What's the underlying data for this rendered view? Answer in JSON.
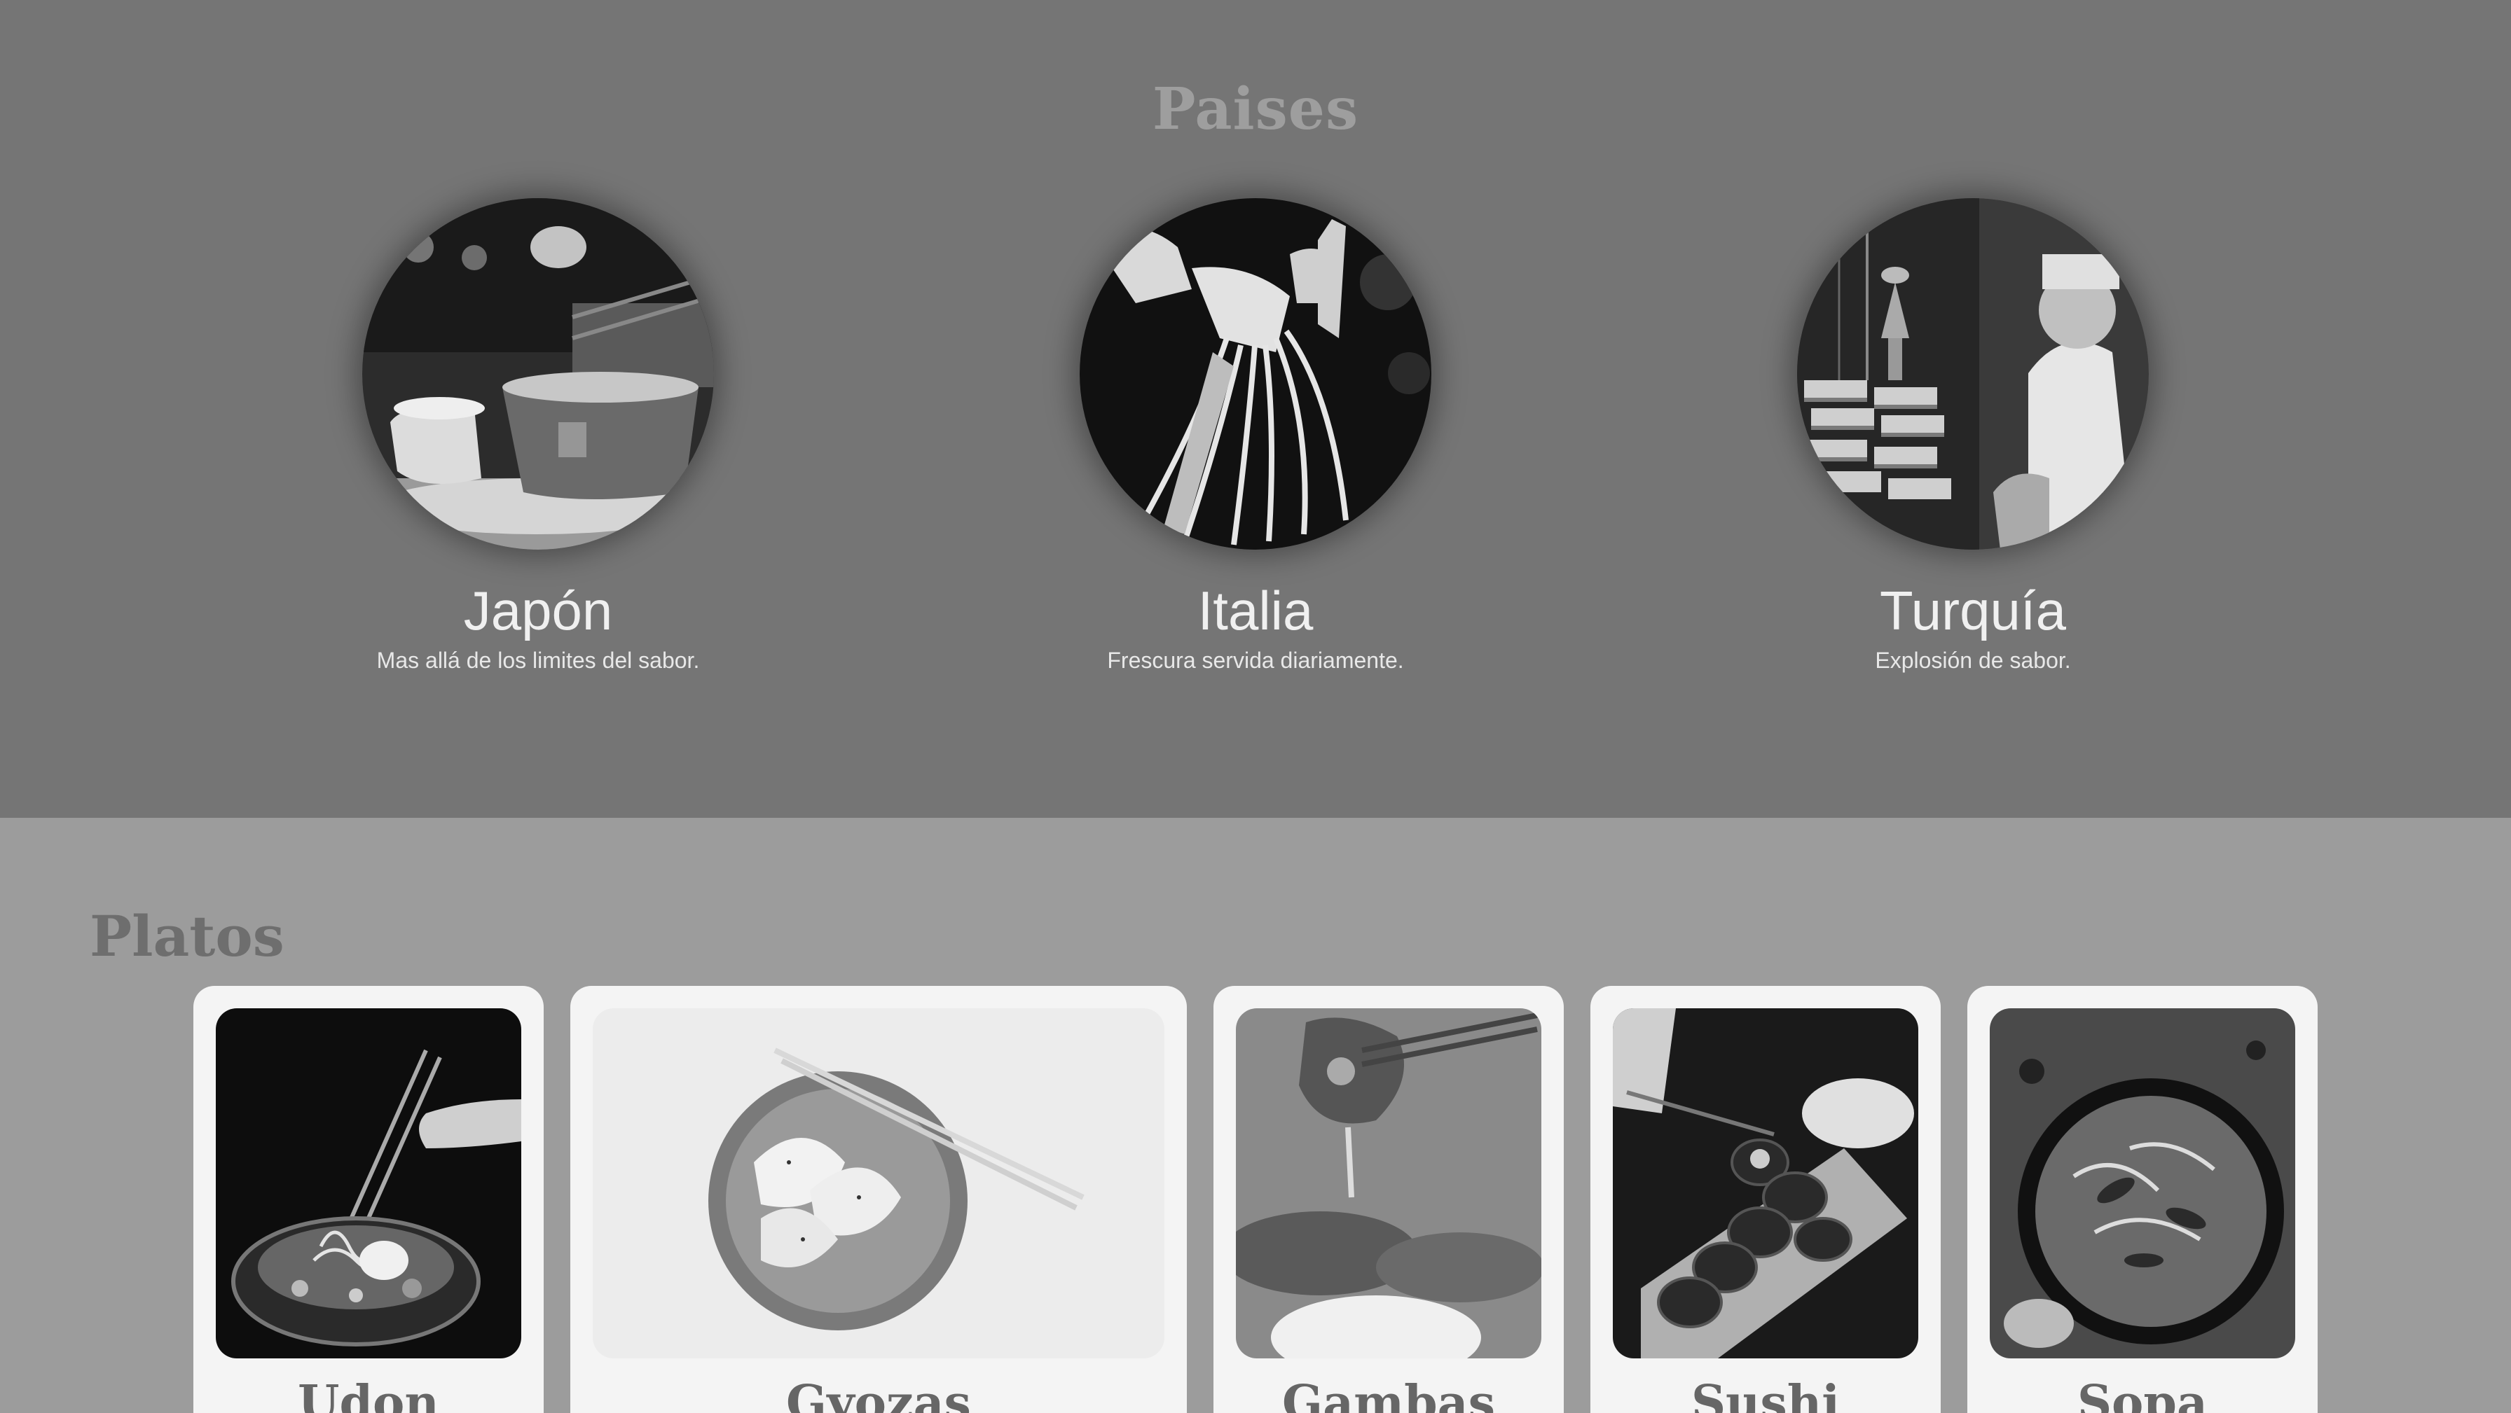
{
  "paises": {
    "title": "Paises",
    "countries": [
      {
        "name": "Japón",
        "description": "Mas allá de los limites del sabor.",
        "image": "tea-cup-photo"
      },
      {
        "name": "Italia",
        "description": "Frescura servida diariamente.",
        "image": "fresh-pasta-photo"
      },
      {
        "name": "Turquía",
        "description": "Explosión de sabor.",
        "image": "turkish-sweets-photo"
      }
    ]
  },
  "platos": {
    "title": "Platos",
    "dishes": [
      {
        "name": "Udon",
        "image": "udon-bowl-photo"
      },
      {
        "name": "Gyozas",
        "image": "gyoza-plate-photo"
      },
      {
        "name": "Gambas",
        "image": "shrimp-photo"
      },
      {
        "name": "Sushi",
        "image": "sushi-rolls-photo"
      },
      {
        "name": "Sopa",
        "image": "soup-bowl-photo"
      }
    ]
  },
  "colors": {
    "top_section_bg": "#757575",
    "bottom_section_bg": "#9c9c9c",
    "card_bg": "#f4f4f4"
  }
}
